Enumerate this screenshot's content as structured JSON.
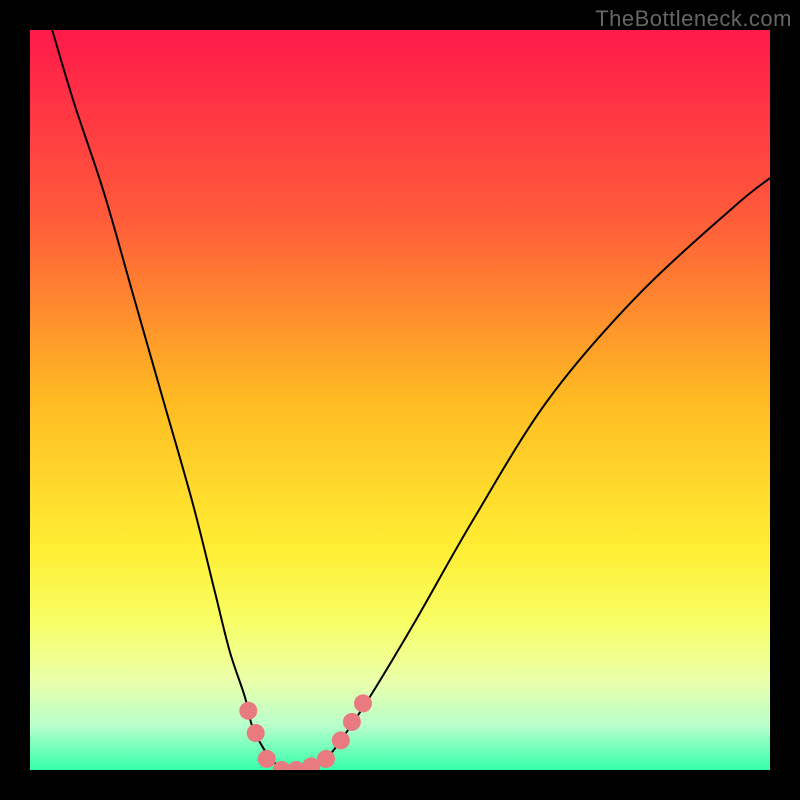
{
  "watermark": "TheBottleneck.com",
  "chart_data": {
    "type": "line",
    "title": "",
    "xlabel": "",
    "ylabel": "",
    "xlim": [
      0,
      100
    ],
    "ylim": [
      0,
      100
    ],
    "background": {
      "type": "vertical_gradient",
      "stops": [
        {
          "pos": 0.0,
          "color": "#ff1a4a"
        },
        {
          "pos": 0.25,
          "color": "#ff5a3a"
        },
        {
          "pos": 0.5,
          "color": "#ffbb22"
        },
        {
          "pos": 0.7,
          "color": "#ffee33"
        },
        {
          "pos": 0.8,
          "color": "#f8ff66"
        },
        {
          "pos": 0.88,
          "color": "#eaffaa"
        },
        {
          "pos": 0.94,
          "color": "#b8ffcc"
        },
        {
          "pos": 1.0,
          "color": "#33ffaa"
        }
      ]
    },
    "series": [
      {
        "name": "bottleneck_curve",
        "color": "#000000",
        "stroke_width": 2,
        "x": [
          3,
          6,
          10,
          14,
          18,
          22,
          25,
          27,
          29,
          30,
          31.5,
          33,
          35,
          37,
          38.5,
          40,
          42,
          46,
          52,
          60,
          70,
          82,
          95,
          100
        ],
        "y": [
          100,
          90,
          78,
          64,
          50,
          36,
          24,
          16,
          10,
          6,
          3,
          1,
          0,
          0,
          0.5,
          1.5,
          4,
          10,
          20,
          34,
          50,
          64,
          76,
          80
        ]
      }
    ],
    "markers": [
      {
        "name": "data_points",
        "color": "#e97a7f",
        "radius": 9,
        "points": [
          {
            "x": 29.5,
            "y": 8
          },
          {
            "x": 30.5,
            "y": 5
          },
          {
            "x": 32,
            "y": 1.5
          },
          {
            "x": 34,
            "y": 0
          },
          {
            "x": 36,
            "y": 0
          },
          {
            "x": 38,
            "y": 0.5
          },
          {
            "x": 40,
            "y": 1.5
          },
          {
            "x": 42,
            "y": 4
          },
          {
            "x": 43.5,
            "y": 6.5
          },
          {
            "x": 45,
            "y": 9
          }
        ]
      }
    ]
  }
}
